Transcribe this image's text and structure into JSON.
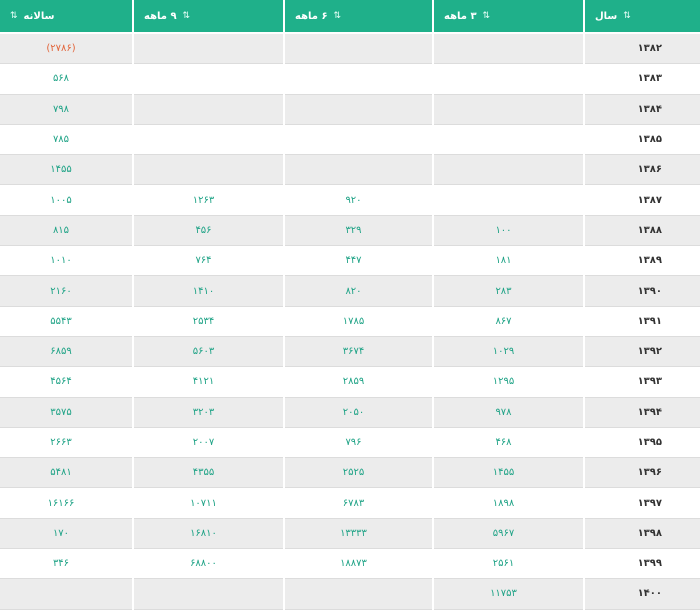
{
  "headers": {
    "annual": "سالانه",
    "nine_month": "۹ ماهه",
    "six_month": "۶ ماهه",
    "three_month": "۳ ماهه",
    "year": "سال",
    "sort_glyph": "⇅"
  },
  "colors": {
    "header_bg": "#1fb08a",
    "value_text": "#1fa386",
    "negative_text": "#e2663c",
    "stripe": "#ececec"
  },
  "rows": [
    {
      "year": "۱۳۸۲",
      "m3": "",
      "m6": "",
      "m9": "",
      "annual": "(۲۷۸۶)"
    },
    {
      "year": "۱۳۸۳",
      "m3": "",
      "m6": "",
      "m9": "",
      "annual": "۵۶۸"
    },
    {
      "year": "۱۳۸۴",
      "m3": "",
      "m6": "",
      "m9": "",
      "annual": "۷۹۸"
    },
    {
      "year": "۱۳۸۵",
      "m3": "",
      "m6": "",
      "m9": "",
      "annual": "۷۸۵"
    },
    {
      "year": "۱۳۸۶",
      "m3": "",
      "m6": "",
      "m9": "",
      "annual": "۱۴۵۵"
    },
    {
      "year": "۱۳۸۷",
      "m3": "",
      "m6": "۹۲۰",
      "m9": "۱۲۶۳",
      "annual": "۱۰۰۵"
    },
    {
      "year": "۱۳۸۸",
      "m3": "۱۰۰",
      "m6": "۳۲۹",
      "m9": "۴۵۶",
      "annual": "۸۱۵"
    },
    {
      "year": "۱۳۸۹",
      "m3": "۱۸۱",
      "m6": "۴۴۷",
      "m9": "۷۶۴",
      "annual": "۱۰۱۰"
    },
    {
      "year": "۱۳۹۰",
      "m3": "۲۸۳",
      "m6": "۸۲۰",
      "m9": "۱۴۱۰",
      "annual": "۲۱۶۰"
    },
    {
      "year": "۱۳۹۱",
      "m3": "۸۶۷",
      "m6": "۱۷۸۵",
      "m9": "۲۵۳۴",
      "annual": "۵۵۴۳"
    },
    {
      "year": "۱۳۹۲",
      "m3": "۱۰۲۹",
      "m6": "۳۶۷۴",
      "m9": "۵۶۰۳",
      "annual": "۶۸۵۹"
    },
    {
      "year": "۱۳۹۳",
      "m3": "۱۲۹۵",
      "m6": "۲۸۵۹",
      "m9": "۴۱۲۱",
      "annual": "۴۵۶۴"
    },
    {
      "year": "۱۳۹۴",
      "m3": "۹۷۸",
      "m6": "۲۰۵۰",
      "m9": "۳۲۰۳",
      "annual": "۳۵۷۵"
    },
    {
      "year": "۱۳۹۵",
      "m3": "۴۶۸",
      "m6": "۷۹۶",
      "m9": "۲۰۰۷",
      "annual": "۲۶۶۳"
    },
    {
      "year": "۱۳۹۶",
      "m3": "۱۴۵۵",
      "m6": "۲۵۲۵",
      "m9": "۴۳۵۵",
      "annual": "۵۴۸۱"
    },
    {
      "year": "۱۳۹۷",
      "m3": "۱۸۹۸",
      "m6": "۶۷۸۳",
      "m9": "۱۰۷۱۱",
      "annual": "۱۶۱۶۶"
    },
    {
      "year": "۱۳۹۸",
      "m3": "۵۹۶۷",
      "m6": "۱۳۳۳۳",
      "m9": "۱۶۸۱۰",
      "annual": "۱۷۰"
    },
    {
      "year": "۱۳۹۹",
      "m3": "۲۵۶۱",
      "m6": "۱۸۸۷۳",
      "m9": "۶۸۸۰۰",
      "annual": "۳۴۶"
    },
    {
      "year": "۱۴۰۰",
      "m3": "۱۱۷۵۳",
      "m6": "",
      "m9": "",
      "annual": ""
    }
  ]
}
